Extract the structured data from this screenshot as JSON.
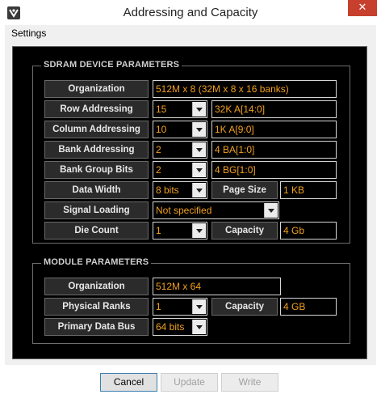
{
  "window": {
    "title": "Addressing and Capacity",
    "close_glyph": "✕",
    "icon": "app-logo-icon"
  },
  "menu": {
    "items": [
      "Settings"
    ]
  },
  "sdram": {
    "title": "SDRAM DEVICE PARAMETERS",
    "organization": {
      "label": "Organization",
      "value": "512M x 8 (32M x 8 x 16 banks)"
    },
    "row_addressing": {
      "label": "Row Addressing",
      "value": "15",
      "detail": "32K A[14:0]"
    },
    "column_addressing": {
      "label": "Column Addressing",
      "value": "10",
      "detail": "1K A[9:0]"
    },
    "bank_addressing": {
      "label": "Bank Addressing",
      "value": "2",
      "detail": "4 BA[1:0]"
    },
    "bank_group_bits": {
      "label": "Bank Group Bits",
      "value": "2",
      "detail": "4 BG[1:0]"
    },
    "data_width": {
      "label": "Data Width",
      "value": "8 bits"
    },
    "page_size": {
      "label": "Page Size",
      "value": "1 KB"
    },
    "signal_loading": {
      "label": "Signal Loading",
      "value": "Not specified"
    },
    "die_count": {
      "label": "Die Count",
      "value": "1"
    },
    "capacity": {
      "label": "Capacity",
      "value": "4 Gb"
    }
  },
  "module": {
    "title": "MODULE PARAMETERS",
    "organization": {
      "label": "Organization",
      "value": "512M x 64"
    },
    "physical_ranks": {
      "label": "Physical Ranks",
      "value": "1"
    },
    "capacity": {
      "label": "Capacity",
      "value": "4 GB"
    },
    "primary_data_bus": {
      "label": "Primary Data Bus",
      "value": "64 bits"
    }
  },
  "buttons": {
    "cancel": "Cancel",
    "update": "Update",
    "write": "Write"
  },
  "colors": {
    "value_text": "#f2a01e",
    "panel_bg": "#000000",
    "label_bg": "#2b2b2b",
    "close_button": "#c7402d"
  }
}
